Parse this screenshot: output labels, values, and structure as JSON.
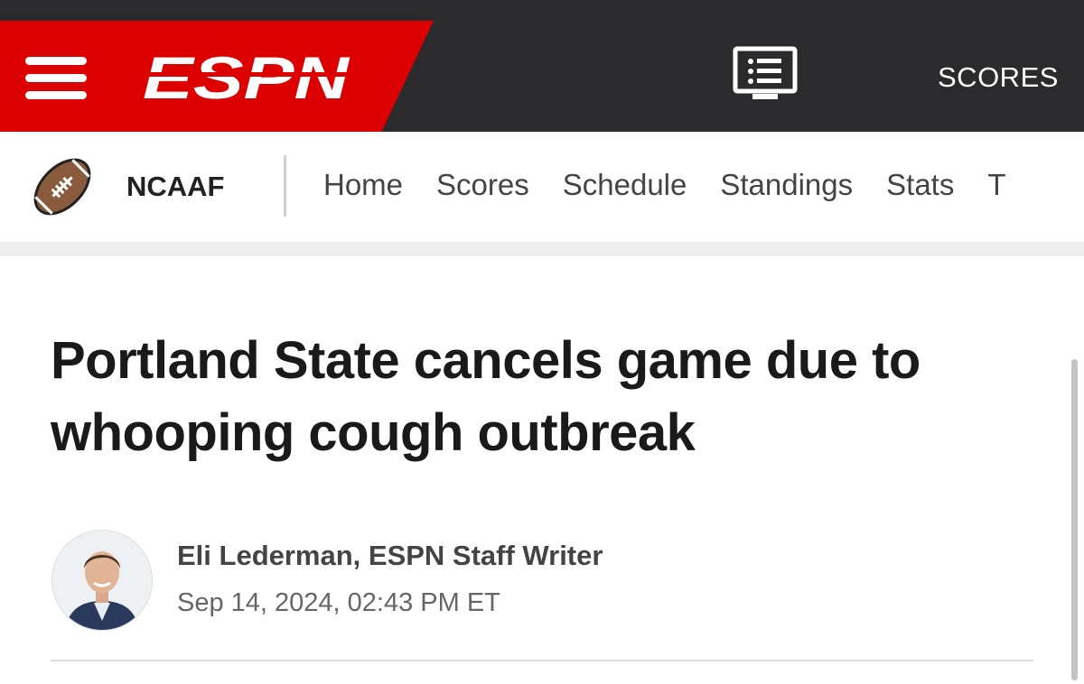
{
  "header": {
    "menu_icon": "hamburger-menu-icon",
    "logo_text": "ESPN",
    "watch_icon": "watch-list-icon",
    "scores_label": "SCORES",
    "brand_color": "#dd0000",
    "bar_color": "#2b2b2d"
  },
  "subnav": {
    "league_icon": "football-icon",
    "league_name": "NCAAF",
    "items": [
      {
        "label": "Home"
      },
      {
        "label": "Scores"
      },
      {
        "label": "Schedule"
      },
      {
        "label": "Standings"
      },
      {
        "label": "Stats"
      },
      {
        "label": "T"
      }
    ]
  },
  "article": {
    "headline": "Portland State cancels game due to whooping cough outbreak",
    "author": "Eli Lederman, ESPN Staff Writer",
    "date": "Sep 14, 2024, 02:43 PM ET"
  }
}
